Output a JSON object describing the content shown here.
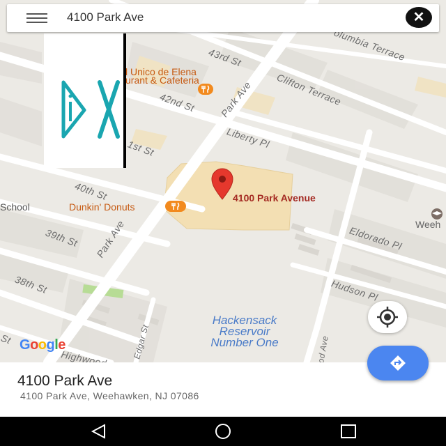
{
  "search": {
    "value": "4100 Park Ave"
  },
  "map": {
    "streets": {
      "s43": "43rd St",
      "s42": "42nd St",
      "s41": "1st St",
      "s40": "40th St",
      "s39": "39th St",
      "s38": "38th St",
      "park1": "Park Ave",
      "park2": "Park Ave",
      "columbia": "olumbia Terrace",
      "clifton": "Clifton Terrace",
      "liberty": "Liberty Pl",
      "eldorado": "Eldorado Pl",
      "hudson": "Hudson Pl",
      "edgar": "Edgar St",
      "highwood": "Highwood",
      "lincoln": "od Ave",
      "st_frag": "St"
    },
    "pois": {
      "unico_line1": "l Unico de Elena",
      "unico_line2": "urant & Cafeteria",
      "dunkin": "Dunkin' Donuts",
      "school": "School",
      "weeh": "Weeh"
    },
    "marker_label": "4100 Park Avenue",
    "water": {
      "line1": "Hackensack",
      "line2": "Reservoir",
      "line3": "Number One"
    },
    "brand": "Google"
  },
  "place": {
    "title": "4100 Park Ave",
    "address": "4100 Park Ave, Weehawken, NJ 07086"
  },
  "colors": {
    "marker": "#e5382d",
    "directions": "#4b86f0",
    "water_text": "#4a7bc8",
    "poi_text": "#c65a12",
    "ad_logo": "#1aa6b0"
  },
  "icons": {
    "menu": "hamburger-menu-icon",
    "clear": "close-icon",
    "locate": "my-location-icon",
    "directions": "directions-icon",
    "back": "back-triangle-icon",
    "home": "home-circle-icon",
    "recents": "recents-square-icon"
  }
}
